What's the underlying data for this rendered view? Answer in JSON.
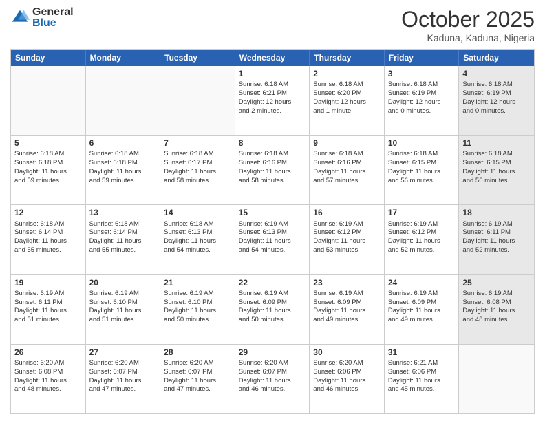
{
  "header": {
    "logo_general": "General",
    "logo_blue": "Blue",
    "month_title": "October 2025",
    "location": "Kaduna, Kaduna, Nigeria"
  },
  "days_of_week": [
    "Sunday",
    "Monday",
    "Tuesday",
    "Wednesday",
    "Thursday",
    "Friday",
    "Saturday"
  ],
  "weeks": [
    [
      {
        "day": "",
        "info": "",
        "empty": true
      },
      {
        "day": "",
        "info": "",
        "empty": true
      },
      {
        "day": "",
        "info": "",
        "empty": true
      },
      {
        "day": "1",
        "info": "Sunrise: 6:18 AM\nSunset: 6:21 PM\nDaylight: 12 hours\nand 2 minutes.",
        "empty": false,
        "shaded": false
      },
      {
        "day": "2",
        "info": "Sunrise: 6:18 AM\nSunset: 6:20 PM\nDaylight: 12 hours\nand 1 minute.",
        "empty": false,
        "shaded": false
      },
      {
        "day": "3",
        "info": "Sunrise: 6:18 AM\nSunset: 6:19 PM\nDaylight: 12 hours\nand 0 minutes.",
        "empty": false,
        "shaded": false
      },
      {
        "day": "4",
        "info": "Sunrise: 6:18 AM\nSunset: 6:19 PM\nDaylight: 12 hours\nand 0 minutes.",
        "empty": false,
        "shaded": true
      }
    ],
    [
      {
        "day": "5",
        "info": "Sunrise: 6:18 AM\nSunset: 6:18 PM\nDaylight: 11 hours\nand 59 minutes.",
        "empty": false,
        "shaded": false
      },
      {
        "day": "6",
        "info": "Sunrise: 6:18 AM\nSunset: 6:18 PM\nDaylight: 11 hours\nand 59 minutes.",
        "empty": false,
        "shaded": false
      },
      {
        "day": "7",
        "info": "Sunrise: 6:18 AM\nSunset: 6:17 PM\nDaylight: 11 hours\nand 58 minutes.",
        "empty": false,
        "shaded": false
      },
      {
        "day": "8",
        "info": "Sunrise: 6:18 AM\nSunset: 6:16 PM\nDaylight: 11 hours\nand 58 minutes.",
        "empty": false,
        "shaded": false
      },
      {
        "day": "9",
        "info": "Sunrise: 6:18 AM\nSunset: 6:16 PM\nDaylight: 11 hours\nand 57 minutes.",
        "empty": false,
        "shaded": false
      },
      {
        "day": "10",
        "info": "Sunrise: 6:18 AM\nSunset: 6:15 PM\nDaylight: 11 hours\nand 56 minutes.",
        "empty": false,
        "shaded": false
      },
      {
        "day": "11",
        "info": "Sunrise: 6:18 AM\nSunset: 6:15 PM\nDaylight: 11 hours\nand 56 minutes.",
        "empty": false,
        "shaded": true
      }
    ],
    [
      {
        "day": "12",
        "info": "Sunrise: 6:18 AM\nSunset: 6:14 PM\nDaylight: 11 hours\nand 55 minutes.",
        "empty": false,
        "shaded": false
      },
      {
        "day": "13",
        "info": "Sunrise: 6:18 AM\nSunset: 6:14 PM\nDaylight: 11 hours\nand 55 minutes.",
        "empty": false,
        "shaded": false
      },
      {
        "day": "14",
        "info": "Sunrise: 6:18 AM\nSunset: 6:13 PM\nDaylight: 11 hours\nand 54 minutes.",
        "empty": false,
        "shaded": false
      },
      {
        "day": "15",
        "info": "Sunrise: 6:19 AM\nSunset: 6:13 PM\nDaylight: 11 hours\nand 54 minutes.",
        "empty": false,
        "shaded": false
      },
      {
        "day": "16",
        "info": "Sunrise: 6:19 AM\nSunset: 6:12 PM\nDaylight: 11 hours\nand 53 minutes.",
        "empty": false,
        "shaded": false
      },
      {
        "day": "17",
        "info": "Sunrise: 6:19 AM\nSunset: 6:12 PM\nDaylight: 11 hours\nand 52 minutes.",
        "empty": false,
        "shaded": false
      },
      {
        "day": "18",
        "info": "Sunrise: 6:19 AM\nSunset: 6:11 PM\nDaylight: 11 hours\nand 52 minutes.",
        "empty": false,
        "shaded": true
      }
    ],
    [
      {
        "day": "19",
        "info": "Sunrise: 6:19 AM\nSunset: 6:11 PM\nDaylight: 11 hours\nand 51 minutes.",
        "empty": false,
        "shaded": false
      },
      {
        "day": "20",
        "info": "Sunrise: 6:19 AM\nSunset: 6:10 PM\nDaylight: 11 hours\nand 51 minutes.",
        "empty": false,
        "shaded": false
      },
      {
        "day": "21",
        "info": "Sunrise: 6:19 AM\nSunset: 6:10 PM\nDaylight: 11 hours\nand 50 minutes.",
        "empty": false,
        "shaded": false
      },
      {
        "day": "22",
        "info": "Sunrise: 6:19 AM\nSunset: 6:09 PM\nDaylight: 11 hours\nand 50 minutes.",
        "empty": false,
        "shaded": false
      },
      {
        "day": "23",
        "info": "Sunrise: 6:19 AM\nSunset: 6:09 PM\nDaylight: 11 hours\nand 49 minutes.",
        "empty": false,
        "shaded": false
      },
      {
        "day": "24",
        "info": "Sunrise: 6:19 AM\nSunset: 6:09 PM\nDaylight: 11 hours\nand 49 minutes.",
        "empty": false,
        "shaded": false
      },
      {
        "day": "25",
        "info": "Sunrise: 6:19 AM\nSunset: 6:08 PM\nDaylight: 11 hours\nand 48 minutes.",
        "empty": false,
        "shaded": true
      }
    ],
    [
      {
        "day": "26",
        "info": "Sunrise: 6:20 AM\nSunset: 6:08 PM\nDaylight: 11 hours\nand 48 minutes.",
        "empty": false,
        "shaded": false
      },
      {
        "day": "27",
        "info": "Sunrise: 6:20 AM\nSunset: 6:07 PM\nDaylight: 11 hours\nand 47 minutes.",
        "empty": false,
        "shaded": false
      },
      {
        "day": "28",
        "info": "Sunrise: 6:20 AM\nSunset: 6:07 PM\nDaylight: 11 hours\nand 47 minutes.",
        "empty": false,
        "shaded": false
      },
      {
        "day": "29",
        "info": "Sunrise: 6:20 AM\nSunset: 6:07 PM\nDaylight: 11 hours\nand 46 minutes.",
        "empty": false,
        "shaded": false
      },
      {
        "day": "30",
        "info": "Sunrise: 6:20 AM\nSunset: 6:06 PM\nDaylight: 11 hours\nand 46 minutes.",
        "empty": false,
        "shaded": false
      },
      {
        "day": "31",
        "info": "Sunrise: 6:21 AM\nSunset: 6:06 PM\nDaylight: 11 hours\nand 45 minutes.",
        "empty": false,
        "shaded": false
      },
      {
        "day": "",
        "info": "",
        "empty": true,
        "shaded": true
      }
    ]
  ]
}
